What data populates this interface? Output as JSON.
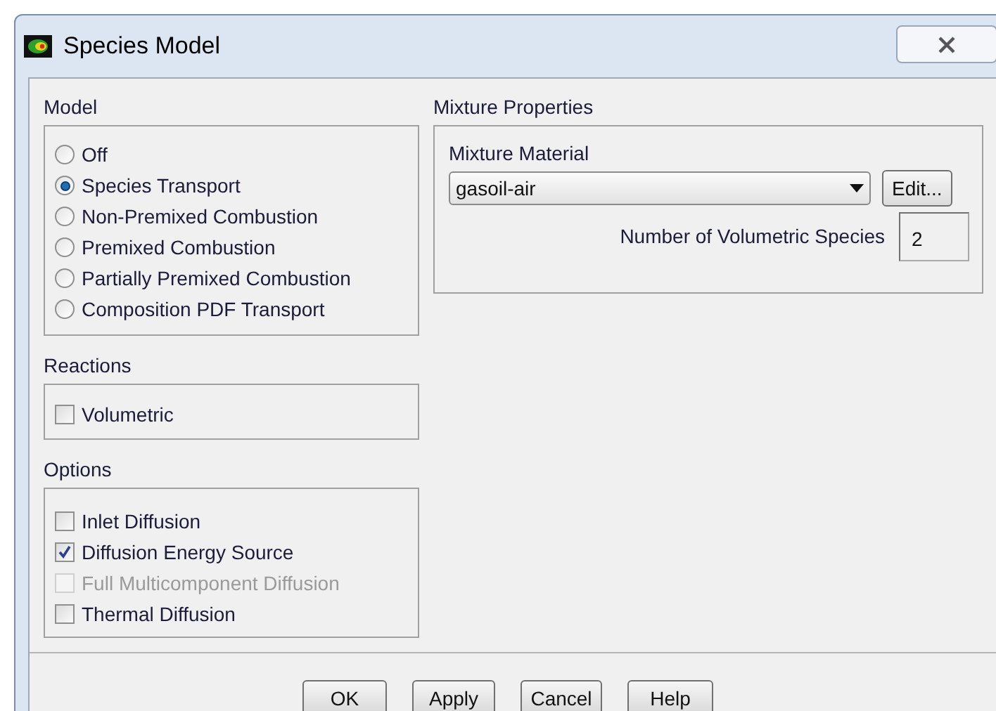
{
  "window": {
    "title": "Species Model"
  },
  "model": {
    "label": "Model",
    "options": [
      {
        "label": "Off",
        "selected": false
      },
      {
        "label": "Species Transport",
        "selected": true
      },
      {
        "label": "Non-Premixed Combustion",
        "selected": false
      },
      {
        "label": "Premixed Combustion",
        "selected": false
      },
      {
        "label": "Partially Premixed Combustion",
        "selected": false
      },
      {
        "label": "Composition PDF Transport",
        "selected": false
      }
    ]
  },
  "reactions": {
    "label": "Reactions",
    "options": [
      {
        "label": "Volumetric",
        "checked": false,
        "disabled": false
      }
    ]
  },
  "options": {
    "label": "Options",
    "items": [
      {
        "label": "Inlet Diffusion",
        "checked": false,
        "disabled": false
      },
      {
        "label": "Diffusion Energy Source",
        "checked": true,
        "disabled": false
      },
      {
        "label": "Full Multicomponent Diffusion",
        "checked": false,
        "disabled": true
      },
      {
        "label": "Thermal Diffusion",
        "checked": false,
        "disabled": false
      }
    ]
  },
  "mixture_properties": {
    "label": "Mixture Properties",
    "material_label": "Mixture Material",
    "material": "gasoil-air",
    "edit_button": "Edit...",
    "species_label": "Number of Volumetric Species",
    "species_count": "2"
  },
  "buttons": [
    "OK",
    "Apply",
    "Cancel",
    "Help"
  ]
}
